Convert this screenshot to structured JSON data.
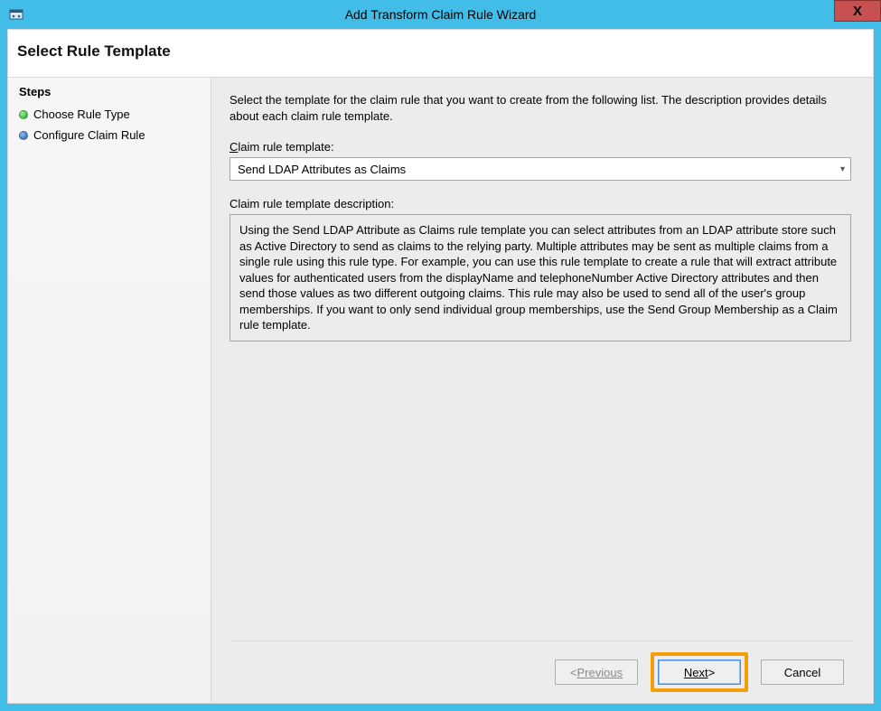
{
  "window": {
    "title": "Add Transform Claim Rule Wizard",
    "close_label": "X"
  },
  "header": {
    "title": "Select Rule Template"
  },
  "sidebar": {
    "heading": "Steps",
    "items": [
      {
        "label": "Choose Rule Type",
        "bullet": "green"
      },
      {
        "label": "Configure Claim Rule",
        "bullet": "blue"
      }
    ]
  },
  "content": {
    "intro": "Select the template for the claim rule that you want to create from the following list. The description provides details about each claim rule template.",
    "template_label": "Claim rule template:",
    "template_value": "Send LDAP Attributes as Claims",
    "description_label": "Claim rule template description:",
    "description_text": "Using the Send LDAP Attribute as Claims rule template you can select attributes from an LDAP attribute store such as Active Directory to send as claims to the relying party. Multiple attributes may be sent as multiple claims from a single rule using this rule type. For example, you can use this rule template to create a rule that will extract attribute values for authenticated users from the displayName and telephoneNumber Active Directory attributes and then send those values as two different outgoing claims. This rule may also be used to send all of the user's group memberships. If you want to only send individual group memberships, use the Send Group Membership as a Claim rule template."
  },
  "buttons": {
    "previous": "Previous",
    "previous_prefix": "< ",
    "next": "Next",
    "next_suffix": " >",
    "cancel": "Cancel"
  },
  "colors": {
    "accent": "#42bde8",
    "close": "#c75050",
    "highlight": "#f59e0b"
  }
}
